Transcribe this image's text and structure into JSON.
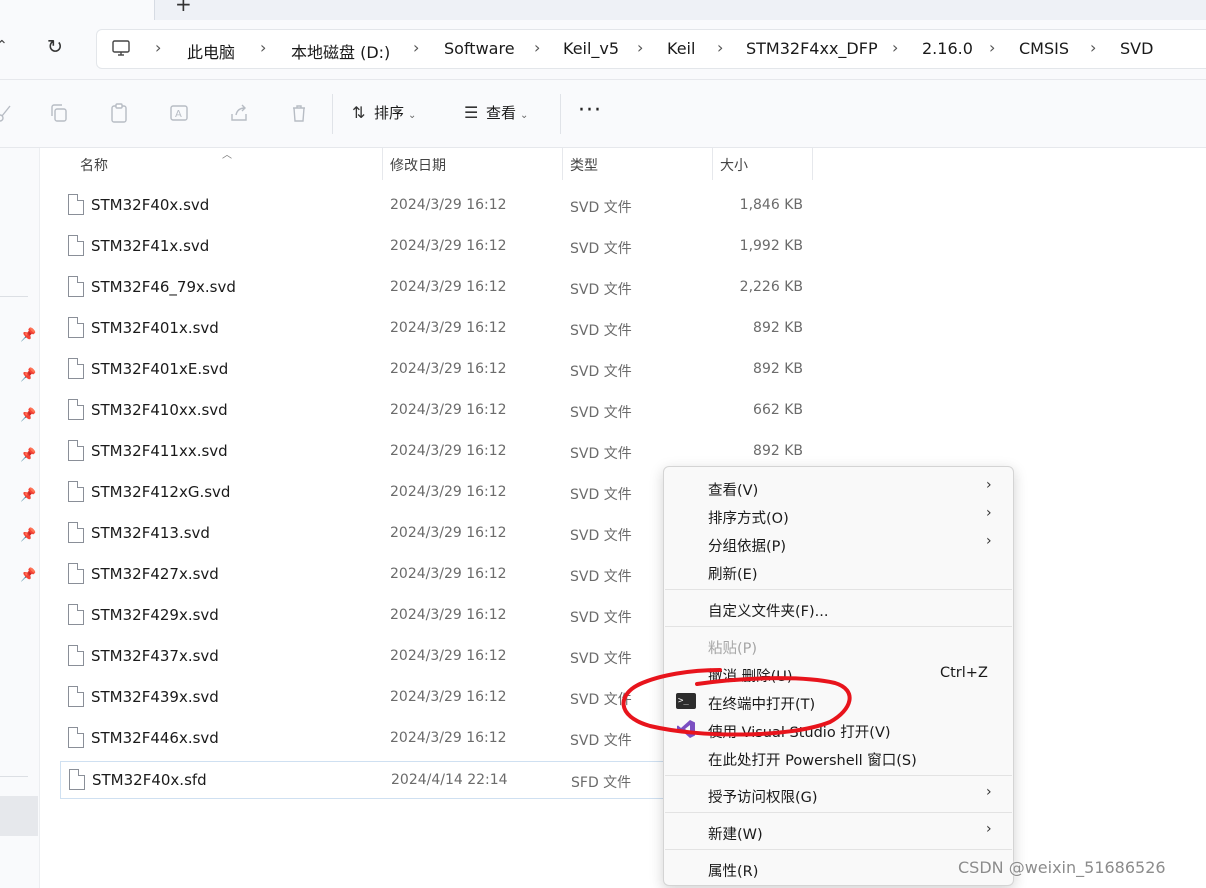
{
  "breadcrumbs": [
    "此电脑",
    "本地磁盘 (D:)",
    "Software",
    "Keil_v5",
    "Keil",
    "STM32F4xx_DFP",
    "2.16.0",
    "CMSIS",
    "SVD"
  ],
  "toolbar": {
    "sort_label": "排序",
    "view_label": "查看",
    "more_label": "···"
  },
  "columns": {
    "name": "名称",
    "date": "修改日期",
    "type": "类型",
    "size": "大小"
  },
  "files": [
    {
      "name": "STM32F40x.svd",
      "date": "2024/3/29 16:12",
      "type": "SVD 文件",
      "size": "1,846 KB"
    },
    {
      "name": "STM32F41x.svd",
      "date": "2024/3/29 16:12",
      "type": "SVD 文件",
      "size": "1,992 KB"
    },
    {
      "name": "STM32F46_79x.svd",
      "date": "2024/3/29 16:12",
      "type": "SVD 文件",
      "size": "2,226 KB"
    },
    {
      "name": "STM32F401x.svd",
      "date": "2024/3/29 16:12",
      "type": "SVD 文件",
      "size": "892 KB"
    },
    {
      "name": "STM32F401xE.svd",
      "date": "2024/3/29 16:12",
      "type": "SVD 文件",
      "size": "892 KB"
    },
    {
      "name": "STM32F410xx.svd",
      "date": "2024/3/29 16:12",
      "type": "SVD 文件",
      "size": "662 KB"
    },
    {
      "name": "STM32F411xx.svd",
      "date": "2024/3/29 16:12",
      "type": "SVD 文件",
      "size": "892 KB"
    },
    {
      "name": "STM32F412xG.svd",
      "date": "2024/3/29 16:12",
      "type": "SVD 文件",
      "size": ""
    },
    {
      "name": "STM32F413.svd",
      "date": "2024/3/29 16:12",
      "type": "SVD 文件",
      "size": ""
    },
    {
      "name": "STM32F427x.svd",
      "date": "2024/3/29 16:12",
      "type": "SVD 文件",
      "size": ""
    },
    {
      "name": "STM32F429x.svd",
      "date": "2024/3/29 16:12",
      "type": "SVD 文件",
      "size": ""
    },
    {
      "name": "STM32F437x.svd",
      "date": "2024/3/29 16:12",
      "type": "SVD 文件",
      "size": ""
    },
    {
      "name": "STM32F439x.svd",
      "date": "2024/3/29 16:12",
      "type": "SVD 文件",
      "size": ""
    },
    {
      "name": "STM32F446x.svd",
      "date": "2024/3/29 16:12",
      "type": "SVD 文件",
      "size": ""
    },
    {
      "name": "STM32F40x.sfd",
      "date": "2024/4/14 22:14",
      "type": "SFD 文件",
      "size": ""
    }
  ],
  "context_menu": {
    "view": "查看(V)",
    "sort_by": "排序方式(O)",
    "group_by": "分组依据(P)",
    "refresh": "刷新(E)",
    "customize_folder": "自定义文件夹(F)...",
    "paste": "粘贴(P)",
    "undo_delete": "撤消 删除(U)",
    "undo_shortcut": "Ctrl+Z",
    "open_in_terminal": "在终端中打开(T)",
    "open_with_vs": "使用 Visual Studio 打开(V)",
    "open_powershell": "在此处打开 Powershell 窗口(S)",
    "grant_access": "授予访问权限(G)",
    "new": "新建(W)",
    "properties": "属性(R)"
  },
  "watermark": "CSDN @weixin_51686526",
  "colors": {
    "annotation_red": "#e8141c",
    "vs_purple": "#7b4fc2",
    "selection_border": "#cfe0f1"
  }
}
